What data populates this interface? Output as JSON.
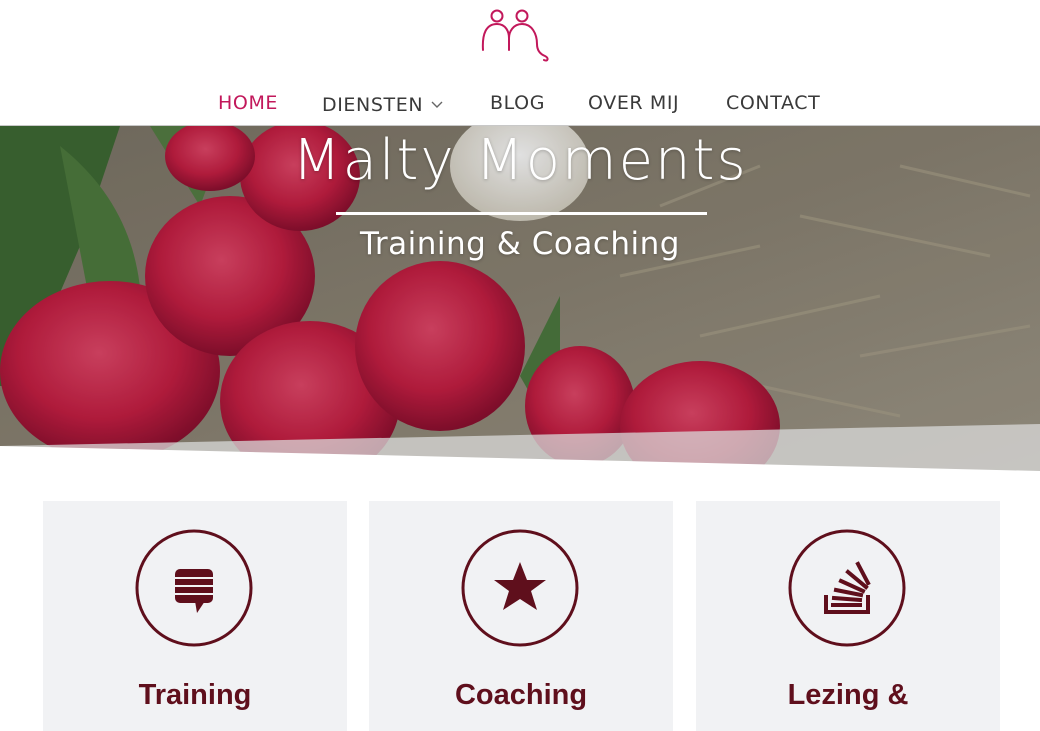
{
  "brand": {
    "accent": "#c2185b",
    "dark_red": "#5f0f1c",
    "logo_icon": "two-figures-logo-icon"
  },
  "nav": {
    "items": [
      {
        "label": "HOME",
        "active": true
      },
      {
        "label": "DIENSTEN",
        "has_dropdown": true
      },
      {
        "label": "BLOG"
      },
      {
        "label": "OVER MIJ"
      },
      {
        "label": "CONTACT"
      }
    ]
  },
  "hero": {
    "title": "Malty Moments",
    "subtitle": "Training & Coaching"
  },
  "cards": [
    {
      "title": "Training",
      "icon": "speech-bubble-icon"
    },
    {
      "title": "Coaching",
      "icon": "star-icon"
    },
    {
      "title": "Lezing &",
      "icon": "stack-overflow-icon"
    }
  ]
}
